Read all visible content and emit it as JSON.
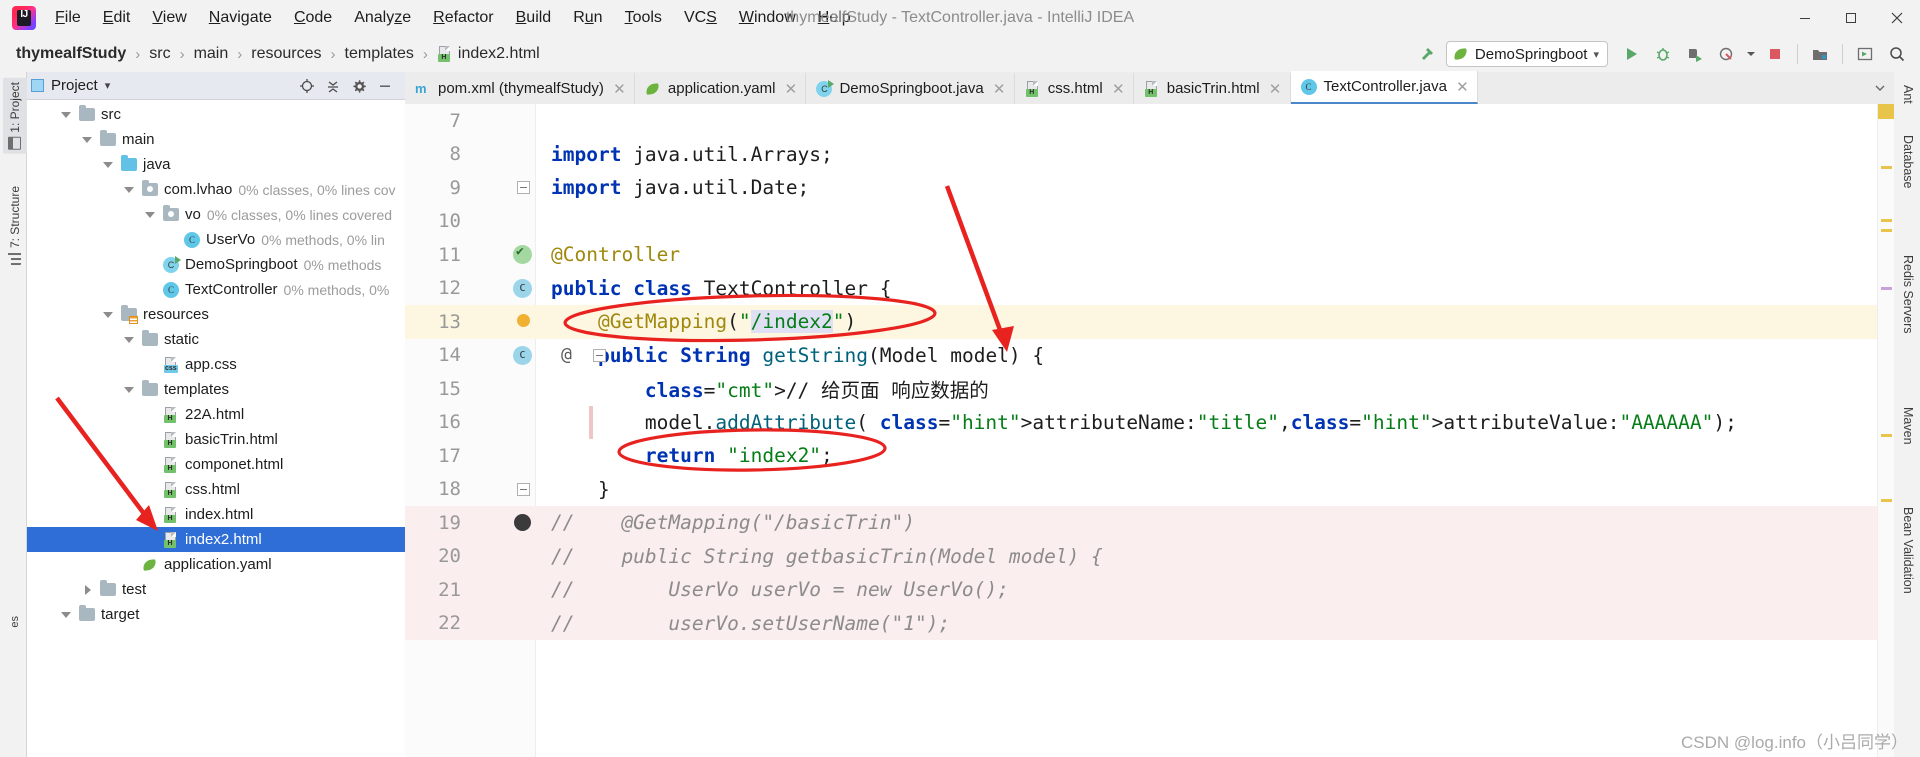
{
  "window": {
    "title": "thymealfStudy - TextController.java - IntelliJ IDEA",
    "minimize": "—",
    "maximize": "❐",
    "close": "✕"
  },
  "menu": {
    "logo_icon": "intellij-idea-logo",
    "items": [
      {
        "label": "File",
        "mnemonic": "F"
      },
      {
        "label": "Edit",
        "mnemonic": "E"
      },
      {
        "label": "View",
        "mnemonic": "V"
      },
      {
        "label": "Navigate",
        "mnemonic": "N"
      },
      {
        "label": "Code",
        "mnemonic": "C"
      },
      {
        "label": "Analyze",
        "mnemonic": "z"
      },
      {
        "label": "Refactor",
        "mnemonic": "R"
      },
      {
        "label": "Build",
        "mnemonic": "B"
      },
      {
        "label": "Run",
        "mnemonic": "u"
      },
      {
        "label": "Tools",
        "mnemonic": "T"
      },
      {
        "label": "VCS",
        "mnemonic": "S"
      },
      {
        "label": "Window",
        "mnemonic": "W"
      },
      {
        "label": "Help",
        "mnemonic": "H"
      }
    ]
  },
  "navbar": {
    "breadcrumbs": [
      {
        "label": "thymealfStudy",
        "bold": true,
        "icon": ""
      },
      {
        "label": "src",
        "bold": false,
        "icon": ""
      },
      {
        "label": "main",
        "bold": false,
        "icon": ""
      },
      {
        "label": "resources",
        "bold": false,
        "icon": ""
      },
      {
        "label": "templates",
        "bold": false,
        "icon": ""
      },
      {
        "label": "index2.html",
        "bold": false,
        "icon": "html-file-icon"
      }
    ],
    "separator": "›",
    "run_config": {
      "label": "DemoSpringboot",
      "icon": "spring-boot-icon",
      "dropdown": "▾"
    },
    "buttons": [
      {
        "name": "build-hammer-button",
        "icon": "hammer-icon"
      },
      {
        "name": "run-button",
        "icon": "run-play-icon"
      },
      {
        "name": "debug-button",
        "icon": "debug-bug-icon"
      },
      {
        "name": "run-with-coverage-button",
        "icon": "coverage-icon"
      },
      {
        "name": "profiler-button",
        "icon": "profiler-icon"
      },
      {
        "name": "stop-button",
        "icon": "stop-square-icon"
      },
      {
        "name": "update-app-button",
        "icon": "update-folder-icon"
      },
      {
        "name": "select-opened-file-button",
        "icon": "select-file-icon"
      },
      {
        "name": "search-everywhere-button",
        "icon": "search-icon"
      }
    ]
  },
  "left_tool_strip": {
    "tabs": [
      {
        "label": "1: Project",
        "icon": "project-panel-icon",
        "selected": true
      },
      {
        "label": "7: Structure",
        "icon": "structure-icon",
        "selected": false
      }
    ],
    "bottom_label": "es"
  },
  "right_tool_strip": {
    "tabs": [
      {
        "label": "Ant",
        "icon": "ant-icon"
      },
      {
        "label": "Database",
        "icon": "database-icon"
      },
      {
        "label": "Redis Servers",
        "icon": "redis-icon"
      },
      {
        "label": "Maven",
        "icon": "maven-icon"
      },
      {
        "label": "Bean Validation",
        "icon": "bean-validation-icon"
      }
    ]
  },
  "project_panel": {
    "title": "Project",
    "title_icon": "project-view-icon",
    "dropdown": "▾",
    "actions": [
      {
        "name": "select-opened-file-button",
        "icon": "crosshair-icon"
      },
      {
        "name": "collapse-all-button",
        "icon": "collapse-all-icon"
      },
      {
        "name": "settings-button",
        "icon": "gear-icon"
      },
      {
        "name": "hide-button",
        "icon": "minimize-icon"
      }
    ],
    "tree": [
      {
        "indent": 1,
        "arrow": "down",
        "icon": "folder-icon",
        "name": "src",
        "coverage": "",
        "selected": false
      },
      {
        "indent": 2,
        "arrow": "down",
        "icon": "folder-icon",
        "name": "main",
        "coverage": "",
        "selected": false
      },
      {
        "indent": 3,
        "arrow": "down",
        "icon": "folder-blue-icon",
        "name": "java",
        "coverage": "",
        "selected": false
      },
      {
        "indent": 4,
        "arrow": "down",
        "icon": "package-icon",
        "name": "com.lvhao",
        "coverage": "0% classes, 0% lines cov",
        "selected": false
      },
      {
        "indent": 5,
        "arrow": "down",
        "icon": "package-icon",
        "name": "vo",
        "coverage": "0% classes, 0% lines covered",
        "selected": false
      },
      {
        "indent": 6,
        "arrow": "none",
        "icon": "java-class-icon",
        "name": "UserVo",
        "coverage": "0% methods, 0% lin",
        "selected": false
      },
      {
        "indent": 5,
        "arrow": "none",
        "icon": "spring-boot-class-icon",
        "name": "DemoSpringboot",
        "coverage": "0% methods",
        "selected": false
      },
      {
        "indent": 5,
        "arrow": "none",
        "icon": "java-class-icon",
        "name": "TextController",
        "coverage": "0% methods, 0%",
        "selected": false
      },
      {
        "indent": 3,
        "arrow": "down",
        "icon": "resources-folder-icon",
        "name": "resources",
        "coverage": "",
        "selected": false
      },
      {
        "indent": 4,
        "arrow": "down",
        "icon": "folder-icon",
        "name": "static",
        "coverage": "",
        "selected": false
      },
      {
        "indent": 5,
        "arrow": "none",
        "icon": "css-file-icon",
        "name": "app.css",
        "coverage": "",
        "selected": false
      },
      {
        "indent": 4,
        "arrow": "down",
        "icon": "folder-icon",
        "name": "templates",
        "coverage": "",
        "selected": false
      },
      {
        "indent": 5,
        "arrow": "none",
        "icon": "html-file-icon",
        "name": "22A.html",
        "coverage": "",
        "selected": false
      },
      {
        "indent": 5,
        "arrow": "none",
        "icon": "html-file-icon",
        "name": "basicTrin.html",
        "coverage": "",
        "selected": false
      },
      {
        "indent": 5,
        "arrow": "none",
        "icon": "html-file-icon",
        "name": "componet.html",
        "coverage": "",
        "selected": false
      },
      {
        "indent": 5,
        "arrow": "none",
        "icon": "html-file-icon",
        "name": "css.html",
        "coverage": "",
        "selected": false
      },
      {
        "indent": 5,
        "arrow": "none",
        "icon": "html-file-icon",
        "name": "index.html",
        "coverage": "",
        "selected": false
      },
      {
        "indent": 5,
        "arrow": "none",
        "icon": "html-file-icon",
        "name": "index2.html",
        "coverage": "",
        "selected": true
      },
      {
        "indent": 4,
        "arrow": "none",
        "icon": "yaml-file-icon",
        "name": "application.yaml",
        "coverage": "",
        "selected": false
      },
      {
        "indent": 2,
        "arrow": "right",
        "icon": "folder-icon",
        "name": "test",
        "coverage": "",
        "selected": false
      },
      {
        "indent": 1,
        "arrow": "down",
        "icon": "folder-icon",
        "name": "target",
        "coverage": "",
        "selected": false
      }
    ]
  },
  "editor_tabs": [
    {
      "label": "pom.xml (thymealfStudy)",
      "icon": "maven-file-icon",
      "active": false,
      "close": "✕"
    },
    {
      "label": "application.yaml",
      "icon": "yaml-file-icon",
      "active": false,
      "close": "✕"
    },
    {
      "label": "DemoSpringboot.java",
      "icon": "spring-boot-class-icon",
      "active": false,
      "close": "✕"
    },
    {
      "label": "css.html",
      "icon": "html-file-icon",
      "active": false,
      "close": "✕"
    },
    {
      "label": "basicTrin.html",
      "icon": "html-file-icon",
      "active": false,
      "close": "✕"
    },
    {
      "label": "TextController.java",
      "icon": "java-class-icon",
      "active": true,
      "close": "✕"
    }
  ],
  "editor_tabs_overflow": "▾",
  "code": {
    "lines": [
      {
        "num": "7",
        "text": "",
        "highlight": "none",
        "gutter": ""
      },
      {
        "num": "8",
        "text": "import java.util.Arrays;",
        "highlight": "none",
        "gutter": ""
      },
      {
        "num": "9",
        "text": "import java.util.Date;",
        "highlight": "none",
        "gutter": "fold"
      },
      {
        "num": "10",
        "text": "",
        "highlight": "none",
        "gutter": ""
      },
      {
        "num": "11",
        "text": "@Controller",
        "highlight": "none",
        "gutter": "run"
      },
      {
        "num": "12",
        "text": "public class TextController {",
        "highlight": "none",
        "gutter": "bean"
      },
      {
        "num": "13",
        "text": "    @GetMapping(\"/index2\")",
        "highlight": "warn",
        "gutter": "bulb"
      },
      {
        "num": "14",
        "text": "    public String getString(Model model) {",
        "highlight": "none",
        "gutter": "bean-at-fold"
      },
      {
        "num": "15",
        "text": "        // 给页面 响应数据的",
        "highlight": "none",
        "gutter": ""
      },
      {
        "num": "16",
        "text": "        model.addAttribute( attributeName: \"title\", attributeValue: \"AAAAAA\");",
        "highlight": "none",
        "gutter": "mod"
      },
      {
        "num": "17",
        "text": "        return \"index2\";",
        "highlight": "none",
        "gutter": ""
      },
      {
        "num": "18",
        "text": "    }",
        "highlight": "none",
        "gutter": "fold"
      },
      {
        "num": "19",
        "text": "//    @GetMapping(\"/basicTrin\")",
        "highlight": "comment",
        "gutter": "breakpoint"
      },
      {
        "num": "20",
        "text": "//    public String getbasicTrin(Model model) {",
        "highlight": "comment",
        "gutter": ""
      },
      {
        "num": "21",
        "text": "//        UserVo userVo = new UserVo();",
        "highlight": "comment",
        "gutter": ""
      },
      {
        "num": "22",
        "text": "//        userVo.setUserName(\"1\");",
        "highlight": "comment",
        "gutter": ""
      }
    ],
    "param_hints": {
      "attribute_name": "attributeName:",
      "attribute_value": "attributeValue:"
    },
    "string_literals": [
      "\"/index2\"",
      "\"title\"",
      "\"AAAAAA\"",
      "\"index2\"",
      "\"/basicTrin\"",
      "\"1\""
    ]
  },
  "annotations": {
    "ellipses": [
      {
        "name": "getmapping-index2-highlight",
        "target": "@GetMapping(\"/index2\")"
      },
      {
        "name": "return-index2-highlight",
        "target": "return \"index2\";"
      }
    ],
    "arrows": [
      {
        "name": "arrow-to-model-param",
        "target": "Model model"
      },
      {
        "name": "arrow-to-index2-html-file",
        "target": "index2.html"
      }
    ],
    "color": "#e8221f"
  },
  "watermark": "CSDN @log.info（小吕同学）"
}
